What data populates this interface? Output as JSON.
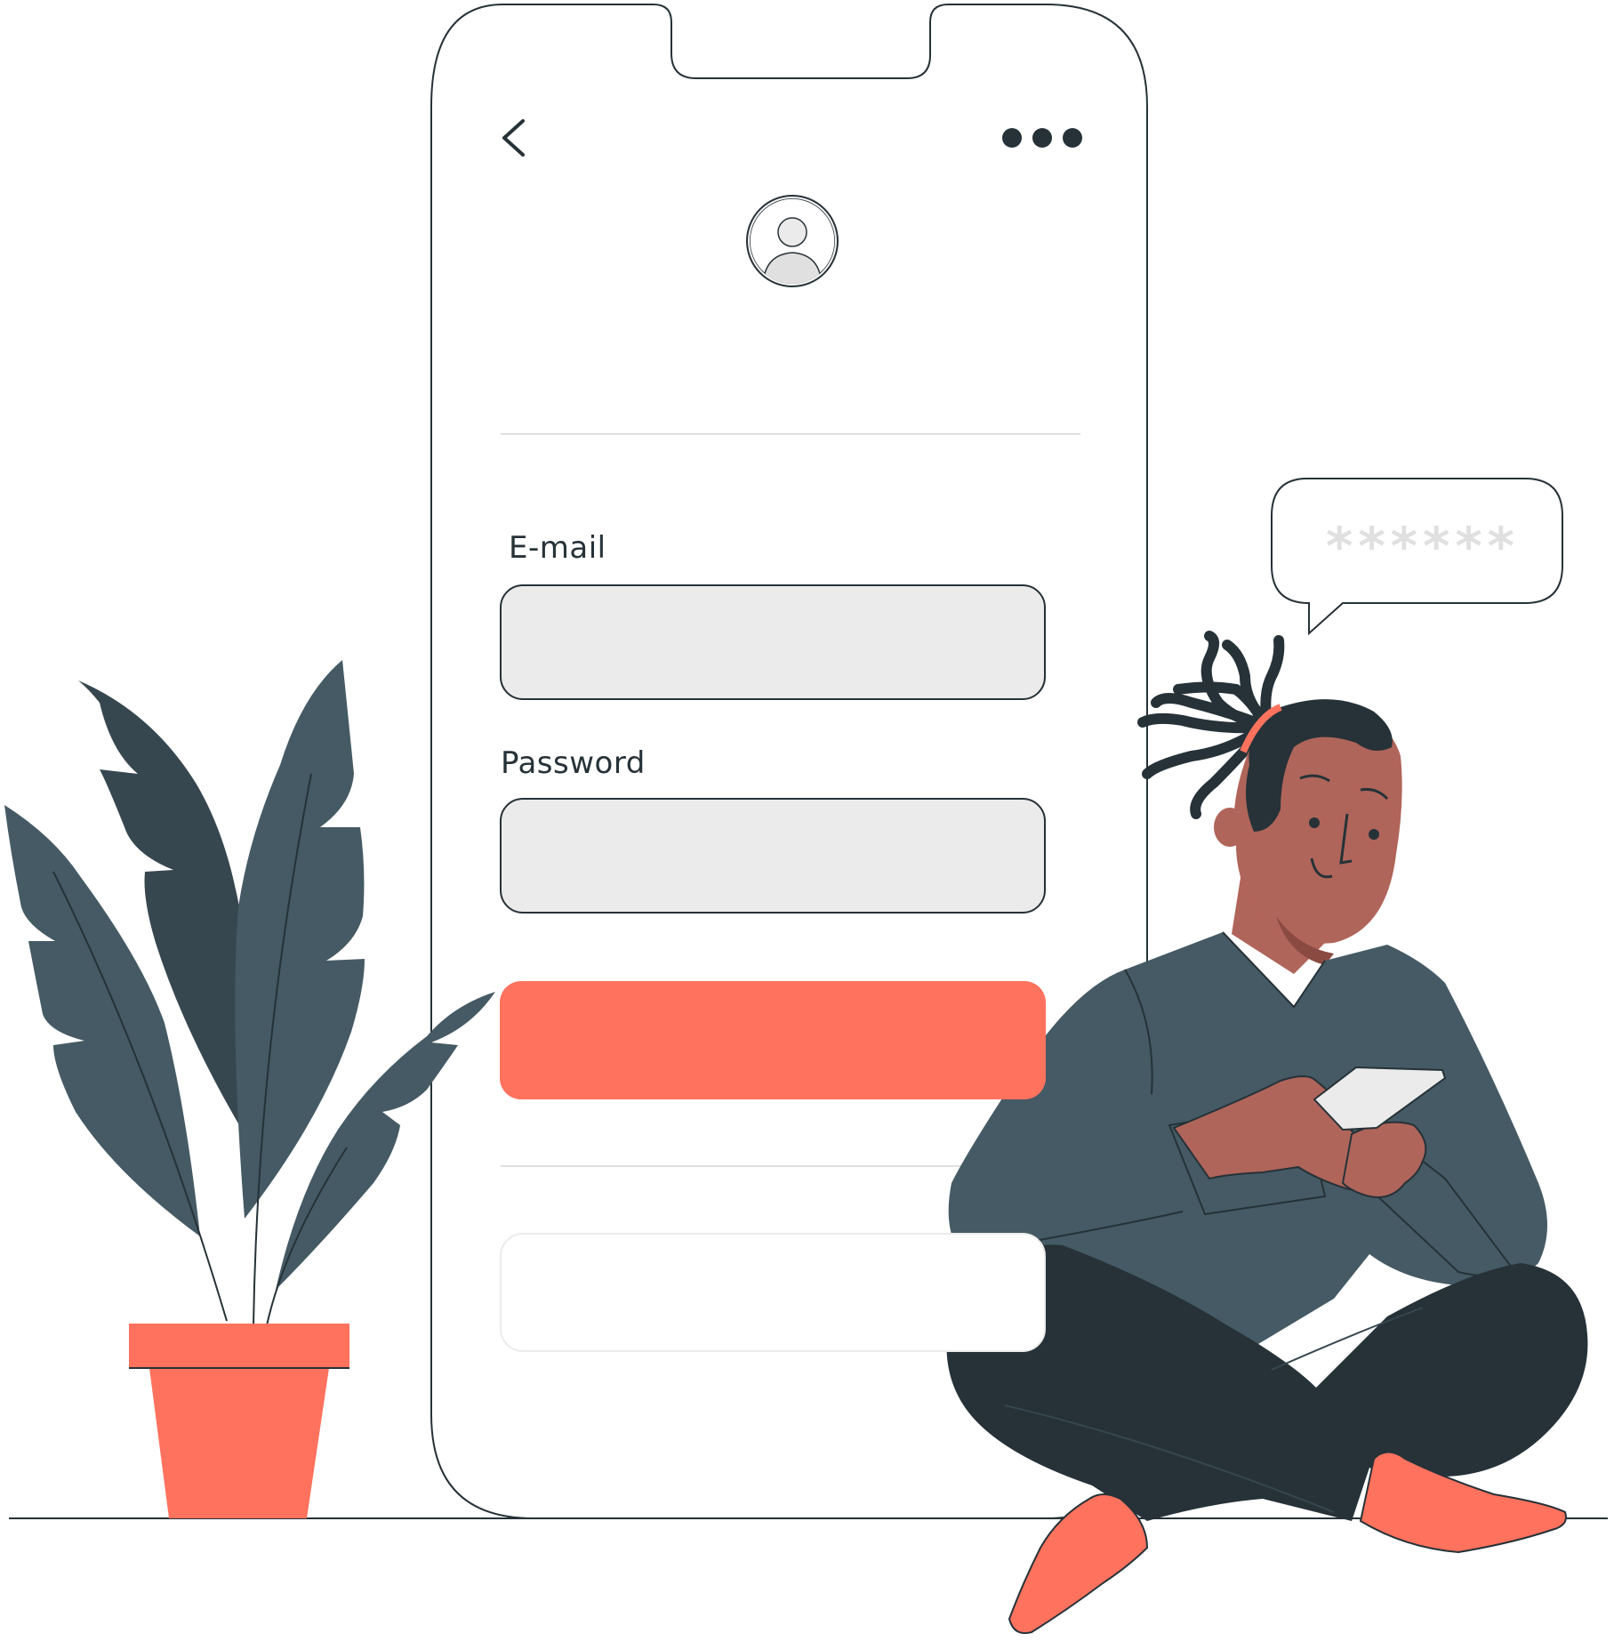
{
  "login_form": {
    "email_label": "E-mail",
    "email_value": "",
    "password_label": "Password",
    "password_value": ""
  },
  "speech_bubble": {
    "text": "******"
  },
  "icons": {
    "back": "chevron-left-icon",
    "more": "more-dots-icon",
    "avatar": "user-avatar-icon"
  },
  "colors": {
    "accent": "#ff725e",
    "dark": "#263238",
    "slate": "#455a64",
    "field_fill": "#ebebeb",
    "skin": "#b0655a"
  }
}
